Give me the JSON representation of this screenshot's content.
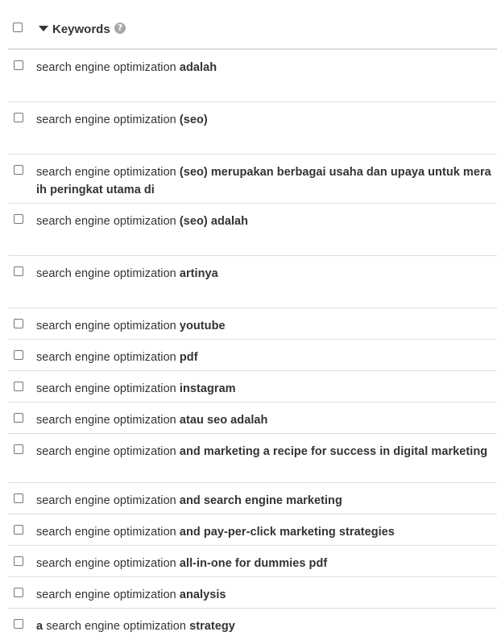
{
  "header": {
    "title": "Keywords",
    "help_glyph": "?"
  },
  "rows": [
    {
      "prefix": "search engine optimization ",
      "bold": "adalah",
      "height": "tall"
    },
    {
      "prefix": "search engine optimization ",
      "bold": "(seo)",
      "height": "tall"
    },
    {
      "prefix": "search engine optimization ",
      "bold": "(seo) merupakan berbagai usaha dan upaya untuk meraih peringkat utama di",
      "height": "wrap"
    },
    {
      "prefix": "search engine optimization ",
      "bold": "(seo) adalah",
      "height": "tall"
    },
    {
      "prefix": "search engine optimization ",
      "bold": "artinya",
      "height": "tall"
    },
    {
      "prefix": "search engine optimization ",
      "bold": "youtube",
      "height": "short"
    },
    {
      "prefix": "search engine optimization ",
      "bold": "pdf",
      "height": "short"
    },
    {
      "prefix": "search engine optimization ",
      "bold": "instagram",
      "height": "short"
    },
    {
      "prefix": "search engine optimization ",
      "bold": "atau seo adalah",
      "height": "short"
    },
    {
      "prefix": "search engine optimization ",
      "bold": "and marketing a recipe for success in digital marketing",
      "height": "wrap"
    },
    {
      "prefix": "search engine optimization ",
      "bold": "and search engine marketing",
      "height": "short"
    },
    {
      "prefix": "search engine optimization ",
      "bold": "and pay-per-click marketing strategies",
      "height": "short"
    },
    {
      "prefix": "search engine optimization ",
      "bold": "all-in-one for dummies pdf",
      "height": "short"
    },
    {
      "prefix": "search engine optimization ",
      "bold": "analysis",
      "height": "short"
    },
    {
      "lead_bold": "a",
      "prefix": " search engine optimization ",
      "bold": "strategy",
      "height": "short"
    }
  ]
}
